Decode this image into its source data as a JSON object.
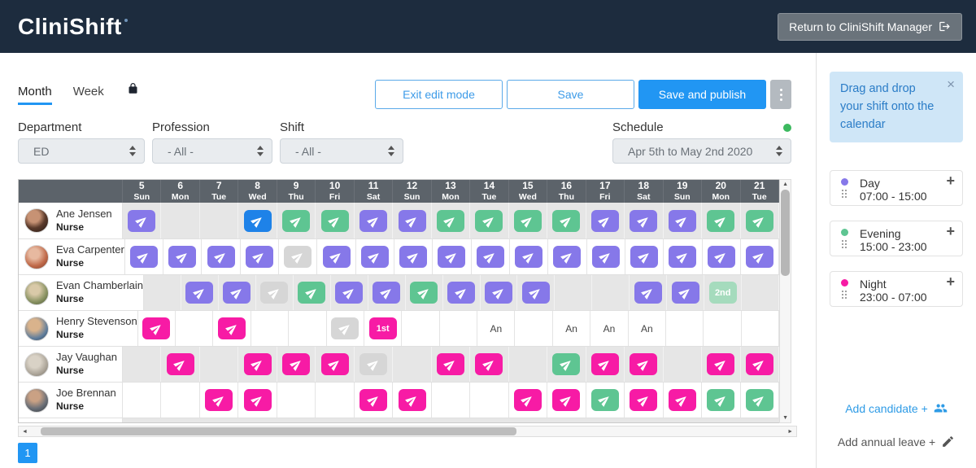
{
  "header": {
    "logo": "CliniShift",
    "return_button": "Return to CliniShift Manager"
  },
  "toolbar": {
    "tabs": [
      {
        "label": "Month",
        "active": true
      },
      {
        "label": "Week",
        "active": false
      }
    ],
    "buttons": {
      "exit": "Exit edit mode",
      "save": "Save",
      "save_publish": "Save and publish"
    }
  },
  "filters": {
    "department": {
      "label": "Department",
      "value": "ED"
    },
    "profession": {
      "label": "Profession",
      "value": "- All -"
    },
    "shift": {
      "label": "Shift",
      "value": "- All -"
    },
    "schedule": {
      "label": "Schedule",
      "value": "Apr 5th to May 2nd 2020"
    }
  },
  "calendar": {
    "days": [
      {
        "date": "5",
        "dow": "Sun"
      },
      {
        "date": "6",
        "dow": "Mon"
      },
      {
        "date": "7",
        "dow": "Tue"
      },
      {
        "date": "8",
        "dow": "Wed"
      },
      {
        "date": "9",
        "dow": "Thu"
      },
      {
        "date": "10",
        "dow": "Fri"
      },
      {
        "date": "11",
        "dow": "Sat"
      },
      {
        "date": "12",
        "dow": "Sun"
      },
      {
        "date": "13",
        "dow": "Mon"
      },
      {
        "date": "14",
        "dow": "Tue"
      },
      {
        "date": "15",
        "dow": "Wed"
      },
      {
        "date": "16",
        "dow": "Thu"
      },
      {
        "date": "17",
        "dow": "Fri"
      },
      {
        "date": "18",
        "dow": "Sat"
      },
      {
        "date": "19",
        "dow": "Sun"
      },
      {
        "date": "20",
        "dow": "Mon"
      },
      {
        "date": "21",
        "dow": "Tue"
      }
    ],
    "badge_labels": {
      "first": "1st",
      "second": "2nd",
      "annual": "An"
    },
    "shift_colors": {
      "day": "#8678e9",
      "evening": "#5ec592",
      "night": "#f71ba5",
      "blue": "#1e82e8",
      "disabled": "#d6d6d6",
      "first": "#f71ba5",
      "second": "#a5dbbd"
    },
    "rows": [
      {
        "name": "Ane Jensen",
        "role": "Nurse",
        "cells": [
          "day",
          "",
          "",
          "blue",
          "evening",
          "evening",
          "day",
          "day",
          "evening",
          "evening",
          "evening",
          "evening",
          "day",
          "day",
          "day",
          "evening",
          "evening"
        ]
      },
      {
        "name": "Eva Carpenter",
        "role": "Nurse",
        "cells": [
          "day",
          "day",
          "day",
          "day",
          "disabled",
          "day",
          "day",
          "day",
          "day",
          "day",
          "day",
          "day",
          "day",
          "day",
          "day",
          "day",
          "day"
        ]
      },
      {
        "name": "Evan Chamberlain",
        "role": "Nurse",
        "cells": [
          "",
          "day",
          "day",
          "disabled",
          "evening",
          "day",
          "day",
          "evening",
          "day",
          "day",
          "day",
          "",
          "",
          "day",
          "day",
          "second",
          ""
        ]
      },
      {
        "name": "Henry Stevenson",
        "role": "Nurse",
        "cells": [
          "night",
          "",
          "night",
          "",
          "",
          "disabled",
          "first",
          "",
          "",
          "annual",
          "",
          "annual",
          "annual",
          "annual",
          "",
          "",
          ""
        ]
      },
      {
        "name": "Jay Vaughan",
        "role": "Nurse",
        "cells": [
          "",
          "night",
          "",
          "night",
          "night",
          "night",
          "disabled",
          "",
          "night",
          "night",
          "",
          "evening",
          "night",
          "night",
          "",
          "night",
          "night"
        ]
      },
      {
        "name": "Joe Brennan",
        "role": "Nurse",
        "cells": [
          "",
          "",
          "night",
          "night",
          "",
          "",
          "night",
          "night",
          "",
          "",
          "night",
          "night",
          "evening",
          "night",
          "night",
          "evening",
          "evening"
        ]
      }
    ]
  },
  "pagination": {
    "page": "1"
  },
  "sidebar": {
    "info": "Drag and drop your shift onto the calendar",
    "shifts": [
      {
        "name": "Day",
        "time": "07:00 - 15:00",
        "color": "#8678e9"
      },
      {
        "name": "Evening",
        "time": "15:00 - 23:00",
        "color": "#5ec592"
      },
      {
        "name": "Night",
        "time": "23:00 - 07:00",
        "color": "#f71ba5"
      }
    ],
    "add_candidate": "Add candidate +",
    "add_annual_leave": "Add annual leave +"
  }
}
